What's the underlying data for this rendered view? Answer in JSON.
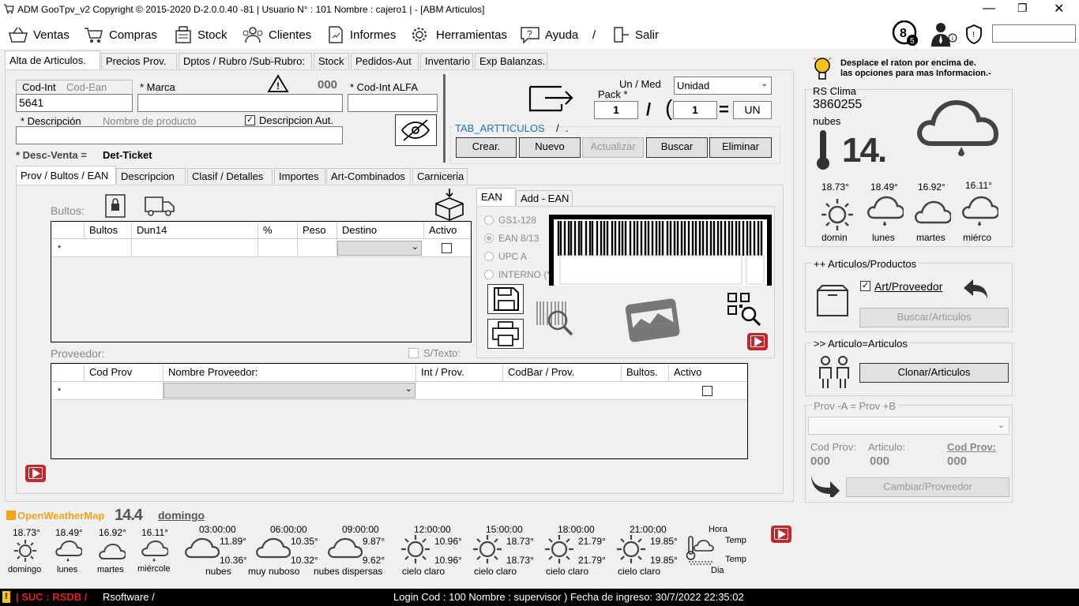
{
  "window": {
    "title": "ADM GooTpv_v2 Copyright ©  2015-2020 D-2.0.0.40 -81 | Usuario N° : 101 Nombre : cajero1 | - [ABM Articulos]"
  },
  "menu": {
    "ventas": "Ventas",
    "compras": "Compras",
    "stock": "Stock",
    "clientes": "Clientes",
    "informes": "Informes",
    "herramientas": "Herramientas",
    "ayuda": "Ayuda",
    "sep": "/",
    "salir": "Salir"
  },
  "tabs": [
    "Alta de Articulos.",
    "Precios Prov.",
    "Dptos / Rubro /Sub-Rubro:",
    "Stock",
    "Pedidos-Aut",
    "Inventario",
    "Exp Balanzas."
  ],
  "form": {
    "codint_label": "Cod-Int",
    "codean_label": "Cod-Ean",
    "codint_value": "5641",
    "marca_label": "* Marca",
    "warn_count": "000",
    "alfa_label": "* Cod-Int ALFA",
    "desc_label": "* Descripción",
    "desc_placeholder": "Nombre de producto",
    "desc_aut_label": "Descripcion Aut.",
    "descventa_label": "* Desc-Venta =",
    "descventa_value": "Det-Ticket"
  },
  "unit": {
    "unmed_label": "Un / Med",
    "unidad_value": "Unidad",
    "pack_label": "Pack *",
    "pack_value": "1",
    "slash": "/",
    "paren": "(",
    "qty_value": "1",
    "eq": "=",
    "un_value": "UN"
  },
  "table_label": {
    "name": "TAB_ARTTICULOS",
    "sep": "/",
    "dot": "."
  },
  "actions": {
    "crear": "Crear.",
    "nuevo": "Nuevo",
    "actualizar": "Actualizar",
    "buscar": "Buscar",
    "eliminar": "Eliminar"
  },
  "subtabs": [
    "Prov / Bultos / EAN",
    "Descripcion",
    "Clasif / Detalles",
    "Importes",
    "Art-Combinados",
    "Carniceria"
  ],
  "bultos": {
    "label": "Bultos:",
    "headers": [
      "Bultos",
      "Dun14",
      "%",
      "Peso",
      "Destino",
      "Activo"
    ],
    "row_marker": "*"
  },
  "proveedor": {
    "label": "Proveedor:",
    "stexto": "S/Texto:",
    "headers": [
      "Cod Prov",
      "Nombre Proveedor:",
      "Int / Prov.",
      "CodBar / Prov.",
      "Bultos.",
      "Activo"
    ],
    "row_marker": "*"
  },
  "ean": {
    "tab1": "EAN",
    "tab2": "Add - EAN",
    "options": [
      "GS1-128",
      "EAN 8/13",
      "UPC A",
      "INTERNO (*)"
    ]
  },
  "tip": {
    "line1": "Desplace el raton por encima de.",
    "line2": "las opciones para mas Informacion.-"
  },
  "weather_box": {
    "label": "RS Clima",
    "code": "3860255",
    "desc": "nubes",
    "temp": "14.",
    "days": [
      {
        "t": "18.73°",
        "d": "domin"
      },
      {
        "t": "18.49°",
        "d": "lunes"
      },
      {
        "t": "16.92°",
        "d": "martes"
      },
      {
        "t": "16.11°",
        "d": "miérco"
      }
    ]
  },
  "articulos": {
    "title": "++ Articulos/Productos",
    "chk_label": "Art/Proveedor",
    "btn": "Buscar/Articulos"
  },
  "clonar": {
    "title": ">> Articulo=Articulos",
    "btn": "Clonar/Articulos"
  },
  "cambio": {
    "title": "Prov -A = Prov +B",
    "codprov": "Cod Prov:",
    "articulo": "Articulo:",
    "codprov2": "Cod Prov:",
    "v1": "000",
    "v2": "000",
    "v3": "000",
    "btn": "Cambiar/Proveedor"
  },
  "forecast": {
    "source": "OpenWeatherMap",
    "temp": "14.4",
    "day": "domingo",
    "days": [
      {
        "t": "18.73°",
        "d": "domingo"
      },
      {
        "t": "18.49°",
        "d": "lunes"
      },
      {
        "t": "16.92°",
        "d": "martes"
      },
      {
        "t": "16.11°",
        "d": "miércole"
      }
    ],
    "hours": [
      {
        "h": "03:00:00",
        "a": "11.89°",
        "b": "10.36°",
        "d": "nubes"
      },
      {
        "h": "06:00:00",
        "a": "10.35°",
        "b": "10.32°",
        "d": "muy nuboso"
      },
      {
        "h": "09:00:00",
        "a": "9.87°",
        "b": "9.62°",
        "d": "nubes dispersas"
      },
      {
        "h": "12:00:00",
        "a": "10.96°",
        "b": "10.96°",
        "d": "cielo claro"
      },
      {
        "h": "15:00:00",
        "a": "18.73°",
        "b": "18.73°",
        "d": "cielo claro"
      },
      {
        "h": "18:00:00",
        "a": "21.79°",
        "b": "21.79°",
        "d": "cielo claro"
      },
      {
        "h": "21:00:00",
        "a": "19.85°",
        "b": "19.85°",
        "d": "cielo claro"
      }
    ],
    "legend": {
      "hora": "Hora",
      "temp1": "Temp",
      "temp2": "Temp",
      "dia": "Dia"
    }
  },
  "status": {
    "suc": "| SUC : RSDB /",
    "rs": "Rsoftware /",
    "login": "Login Cod : 100 Nombre : supervisor ) Fecha de ingreso: 30/7/2022 22:35:02"
  },
  "colors": {
    "accent": "#1e6fc5",
    "warn": "#e8a000",
    "yt": "#c0282c"
  }
}
